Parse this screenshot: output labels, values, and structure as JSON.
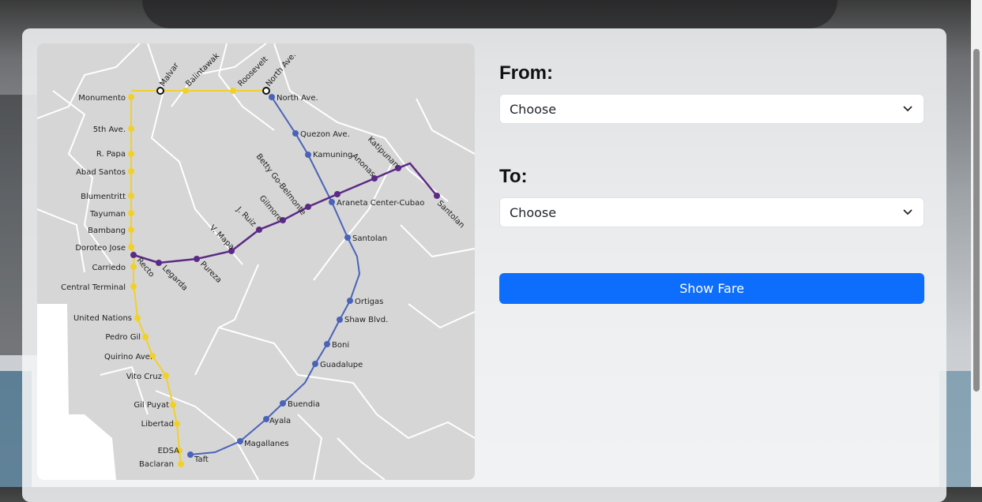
{
  "form": {
    "from_label": "From:",
    "from_value": "Choose",
    "to_label": "To:",
    "to_value": "Choose",
    "submit_label": "Show Fare"
  },
  "map": {
    "lines": {
      "line1_color": "#f2d02a",
      "line2_color": "#5b2a86",
      "line3_color": "#4a63b8"
    },
    "stations": {
      "monumento": "Monumento",
      "fifth_ave": "5th Ave.",
      "r_papa": "R. Papa",
      "abad_santos": "Abad Santos",
      "blumentritt": "Blumentritt",
      "tayuman": "Tayuman",
      "bambang": "Bambang",
      "doroteo_jose": "Doroteo Jose",
      "carriedo": "Carriedo",
      "central_terminal": "Central Terminal",
      "united_nations": "United Nations",
      "pedro_gil": "Pedro Gil",
      "quirino_ave": "Quirino Ave.",
      "vito_cruz": "Vito Cruz",
      "gil_puyat": "Gil Puyat",
      "libertad": "Libertad",
      "edsa": "EDSA",
      "baclaran": "Baclaran",
      "malvar": "Malvar",
      "balintawak": "Balintawak",
      "roosevelt": "Roosevelt",
      "north_ave_top": "North Ave.",
      "north_ave": "North Ave.",
      "quezon_ave": "Quezon Ave.",
      "kamuning": "Kamuning",
      "araneta_cubao": "Araneta Center-Cubao",
      "santolan_l3": "Santolan",
      "ortigas": "Ortigas",
      "shaw_blvd": "Shaw Blvd.",
      "boni": "Boni",
      "guadalupe": "Guadalupe",
      "buendia": "Buendia",
      "ayala": "Ayala",
      "magallanes": "Magallanes",
      "taft": "Taft",
      "recto": "Recto",
      "legarda": "Legarda",
      "pureza": "Pureza",
      "v_mapa": "V. Mapa",
      "j_ruiz": "J. Ruiz",
      "gilmore": "Gilmore",
      "betty_go": "Betty Go-Belmonte",
      "anonas": "Anonas",
      "katipunan": "Katipunan",
      "santolan_l2": "Santolan"
    }
  }
}
